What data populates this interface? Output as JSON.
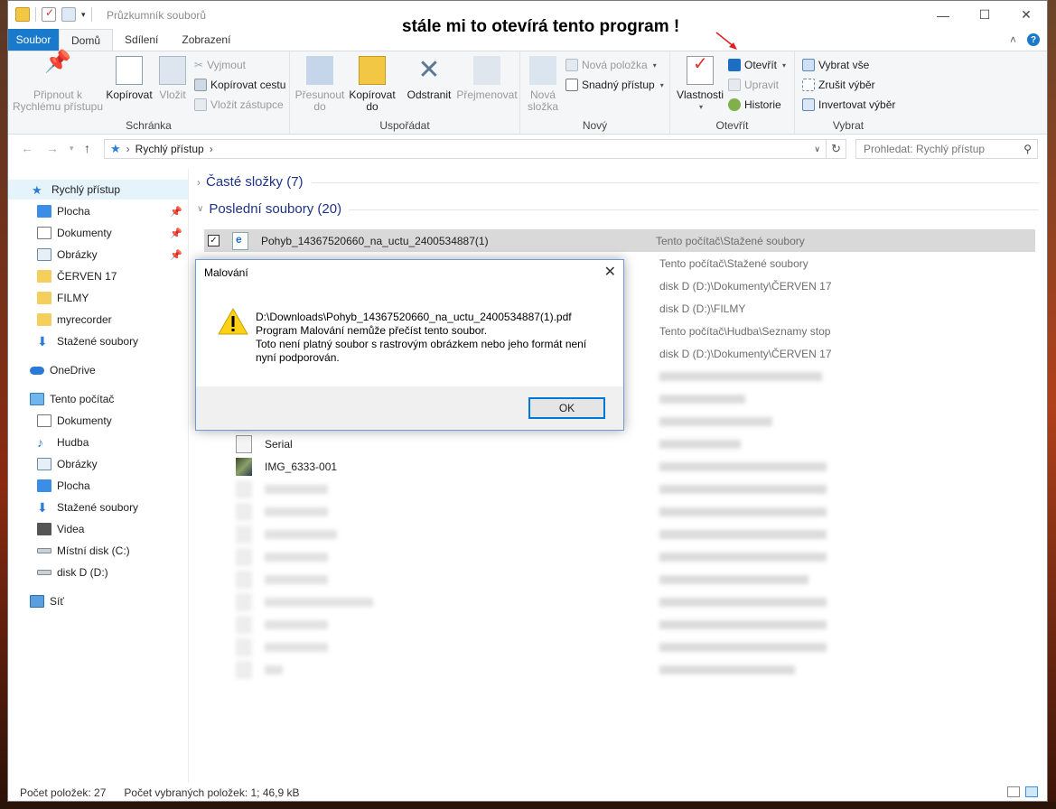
{
  "window": {
    "title": "Průzkumník souborů"
  },
  "annotation": {
    "text": "stále mi to otevírá tento program !"
  },
  "tabs": [
    {
      "label": "Soubor"
    },
    {
      "label": "Domů"
    },
    {
      "label": "Sdílení"
    },
    {
      "label": "Zobrazení"
    }
  ],
  "ribbon": {
    "clipboard": {
      "pin_label": "Připnout k Rychlému přístupu",
      "copy_label": "Kopírovat",
      "paste_label": "Vložit",
      "cut_label": "Vyjmout",
      "copy_path_label": "Kopírovat cestu",
      "paste_shortcut_label": "Vložit zástupce",
      "group_label": "Schránka"
    },
    "organize": {
      "move_label": "Přesunout do",
      "copyto_label": "Kopírovat do",
      "delete_label": "Odstranit",
      "rename_label": "Přejmenovat",
      "group_label": "Uspořádat"
    },
    "new": {
      "new_folder_label": "Nová složka",
      "new_item_label": "Nová položka",
      "easy_access_label": "Snadný přístup",
      "group_label": "Nový"
    },
    "open": {
      "properties_label": "Vlastnosti",
      "open_label": "Otevřít",
      "edit_label": "Upravit",
      "history_label": "Historie",
      "group_label": "Otevřít"
    },
    "select": {
      "select_all_label": "Vybrat vše",
      "select_none_label": "Zrušit výběr",
      "invert_label": "Invertovat výběr",
      "group_label": "Vybrat"
    }
  },
  "address": {
    "path": "Rychlý přístup",
    "search_placeholder": "Prohledat: Rychlý přístup"
  },
  "nav": {
    "quick_access": "Rychlý přístup",
    "desktop": "Plocha",
    "documents": "Dokumenty",
    "pictures": "Obrázky",
    "cerven": "ČERVEN 17",
    "filmy": "FILMY",
    "myrecorder": "myrecorder",
    "downloads": "Stažené soubory",
    "onedrive": "OneDrive",
    "this_pc": "Tento počítač",
    "pc_documents": "Dokumenty",
    "music": "Hudba",
    "pc_pictures": "Obrázky",
    "pc_desktop": "Plocha",
    "pc_downloads": "Stažené soubory",
    "videos": "Videa",
    "local_c": "Místní disk (C:)",
    "disk_d": "disk D (D:)",
    "network": "Síť"
  },
  "content": {
    "frequent_header": "Časté složky (7)",
    "recent_header": "Poslední soubory (20)",
    "rows": [
      {
        "name": "Pohyb_14367520660_na_uctu_2400534887(1)",
        "location": "Tento počítač\\Stažené soubory"
      },
      {
        "name": "",
        "location": "Tento počítač\\Stažené soubory"
      },
      {
        "name": "",
        "location": "disk D (D:)\\Dokumenty\\ČERVEN 17"
      },
      {
        "name": "",
        "location": "disk D (D:)\\FILMY"
      },
      {
        "name": "",
        "location": "Tento počítač\\Hudba\\Seznamy stop"
      },
      {
        "name": "",
        "location": "disk D (D:)\\Dokumenty\\ČERVEN 17"
      },
      {
        "name": "Serial",
        "location": ""
      },
      {
        "name": "IMG_6333-001",
        "location": ""
      }
    ]
  },
  "status": {
    "count": "Počet položek: 27",
    "selected": "Počet vybraných položek: 1; 46,9 kB"
  },
  "dialog": {
    "title": "Malování",
    "path": "D:\\Downloads\\Pohyb_14367520660_na_uctu_2400534887(1).pdf",
    "line1": "Program Malování nemůže přečíst tento soubor.",
    "line2": "Toto není platný soubor s rastrovým obrázkem nebo jeho formát není nyní podporován.",
    "ok_label": "OK"
  }
}
